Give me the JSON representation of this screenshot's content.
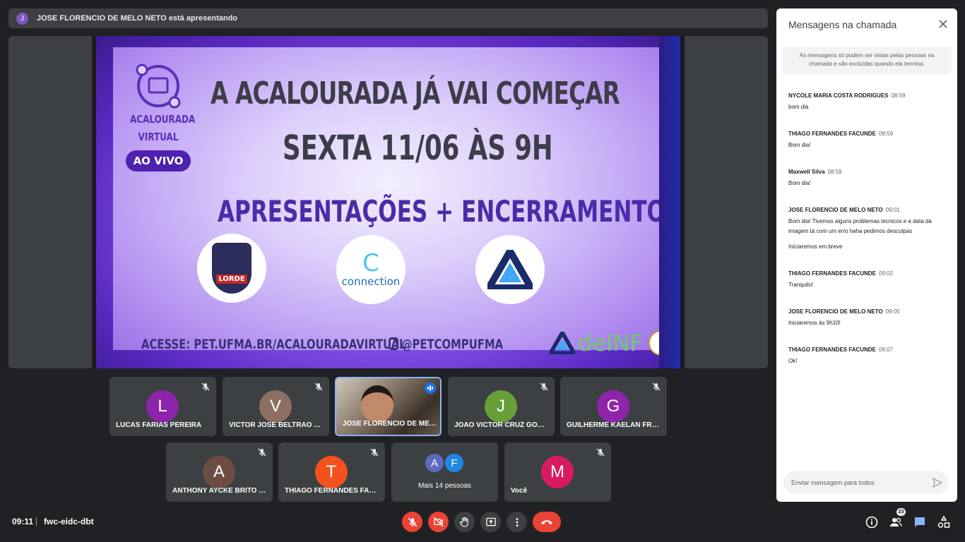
{
  "presenting": {
    "initial": "J",
    "text": "JOSE FLORENCIO DE MELO NETO está apresentando"
  },
  "slide": {
    "title": "A ACALOURADA JÁ VAI COMEÇAR",
    "date": "SEXTA 11/06 ÀS 9H",
    "subtitle": "APRESENTAÇÕES + ENCERRAMENTO",
    "badge_line1": "ACALOURADA",
    "badge_line2": "VIRTUAL",
    "badge_pill": "AO VIVO",
    "logo1": "LORDE",
    "logo2": "connection",
    "url": "ACESSE: PET.UFMA.BR/ACALOURADAVIRTUAL",
    "instagram": "@PETCOMPUFMA",
    "dept": "deINF"
  },
  "participants": [
    {
      "initial": "L",
      "name": "LUCAS FARIAS PEREIRA",
      "color": "#8e24aa"
    },
    {
      "initial": "V",
      "name": "VICTOR JOSE BELTRAO ALMEIDA",
      "color": "#8d6e63"
    },
    {
      "initial": "",
      "name": "JOSE FLORENCIO DE MELO NETO",
      "color": "#000"
    },
    {
      "initial": "J",
      "name": "JOAO VICTOR CRUZ GONÇALVES",
      "color": "#689f38"
    },
    {
      "initial": "G",
      "name": "GUILHERME KAELAN FRANCO",
      "color": "#8e24aa"
    },
    {
      "initial": "A",
      "name": "ANTHONY AYCKE BRITO LIMA",
      "color": "#6d4c41"
    },
    {
      "initial": "T",
      "name": "THIAGO FERNANDES FACUNDE",
      "color": "#f4511e"
    },
    {
      "initial": "M",
      "name": "Você",
      "color": "#d81b60"
    }
  ],
  "more": {
    "a": "A",
    "f": "F",
    "label": "Mais 14 pessoas"
  },
  "chat": {
    "title": "Mensagens na chamada",
    "note": "As mensagens só podem ser vistas pelas pessoas na chamada e são excluídas quando ela termina.",
    "messages": [
      {
        "who": "NYCOLE MARIA COSTA RODRIGUES",
        "time": "08:59",
        "lines": [
          "bom dia"
        ]
      },
      {
        "who": "THIAGO FERNANDES FACUNDE",
        "time": "08:59",
        "lines": [
          "Bom dia!"
        ]
      },
      {
        "who": "Maxwell Silva",
        "time": "08:59",
        "lines": [
          "Bom dia!"
        ]
      },
      {
        "who": "JOSE FLORENCIO DE MELO NETO",
        "time": "09:01",
        "lines": [
          "Bom dia! Tivemos alguns problemas tecnicos e a data da imagem tá com um erro haha pedimos desculpas",
          "Iniciaremos em breve"
        ]
      },
      {
        "who": "THIAGO FERNANDES FACUNDE",
        "time": "09:02",
        "lines": [
          "Tranquilo!"
        ]
      },
      {
        "who": "JOSE FLORENCIO DE MELO NETO",
        "time": "09:05",
        "lines": [
          "Iniciaremos às 9h10!"
        ]
      },
      {
        "who": "THIAGO FERNANDES FACUNDE",
        "time": "09:07",
        "lines": [
          "Ok!"
        ]
      }
    ],
    "input_placeholder": "Enviar mensagem para todos"
  },
  "bottom": {
    "time": "09:11",
    "meeting_code": "fwc-eidc-dbt",
    "participant_count": "23"
  }
}
